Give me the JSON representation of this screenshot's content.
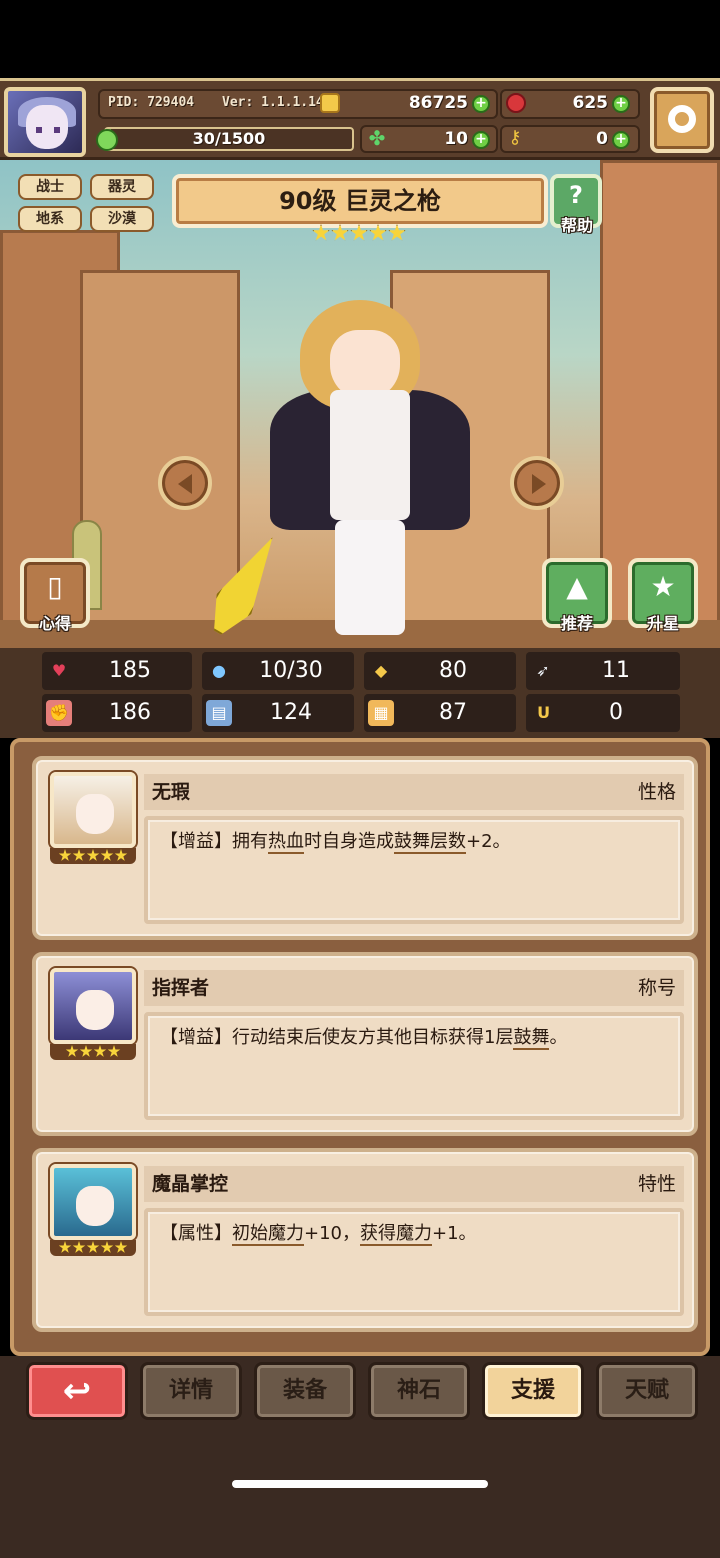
{
  "header": {
    "pid": "PID: 729404",
    "version": "Ver: 1.1.1.14",
    "coins": "86725",
    "gems": "625",
    "energy": "30/1500",
    "energy_fraction": 0.02,
    "clover": "10",
    "keys": "0"
  },
  "hero": {
    "tags": [
      "战士",
      "器灵",
      "地系",
      "沙漠"
    ],
    "title": "90级  巨灵之枪",
    "stars": 5,
    "help_label": "帮助",
    "left_button_label": "心得",
    "recommend_label": "推荐",
    "star_up_label": "升星"
  },
  "stats": {
    "hp": "185",
    "mana": "10/30",
    "defense": "80",
    "speed": "11",
    "attack": "186",
    "magic": "124",
    "block": "87",
    "luck": "0"
  },
  "cards": [
    {
      "name": "无瑕",
      "type": "性格",
      "stars": 5,
      "desc_prefix": "【增益】拥有",
      "desc_u1": "热血",
      "desc_mid": "时自身造成",
      "desc_u2": "鼓舞层数",
      "desc_suffix": "+2。"
    },
    {
      "name": "指挥者",
      "type": "称号",
      "stars": 4,
      "desc_prefix": "【增益】行动结束后使友方其他目标获得1层",
      "desc_u1": "鼓舞",
      "desc_suffix": "。"
    },
    {
      "name": "魔晶掌控",
      "type": "特性",
      "stars": 5,
      "desc_prefix": "【属性】",
      "desc_u1": "初始魔力",
      "desc_mid": "+10，",
      "desc_u2": "获得魔力",
      "desc_suffix": "+1。"
    }
  ],
  "nav": {
    "back": "↩",
    "details": "详情",
    "equipment": "装备",
    "godstone": "神石",
    "support": "支援",
    "talent": "天赋"
  },
  "colors": {
    "accent": "#f2d39b",
    "panel": "#8a5f3f",
    "card": "#efdcc4",
    "back_button": "#e05050"
  }
}
